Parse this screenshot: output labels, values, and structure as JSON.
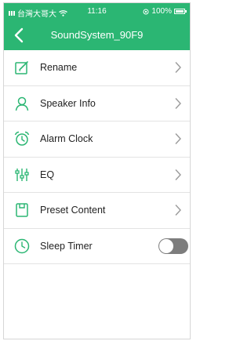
{
  "status_bar": {
    "carrier": "台灣大哥大",
    "time": "11:16",
    "battery": "100%"
  },
  "header": {
    "title": "SoundSystem_90F9",
    "back_icon": "chevron-left-icon"
  },
  "menu": [
    {
      "label": "Rename",
      "icon": "edit-icon",
      "control": "chevron"
    },
    {
      "label": "Speaker Info",
      "icon": "person-icon",
      "control": "chevron"
    },
    {
      "label": "Alarm Clock",
      "icon": "alarm-clock-icon",
      "control": "chevron"
    },
    {
      "label": "EQ",
      "icon": "equalizer-icon",
      "control": "chevron"
    },
    {
      "label": "Preset Content",
      "icon": "preset-icon",
      "control": "chevron"
    },
    {
      "label": "Sleep Timer",
      "icon": "clock-icon",
      "control": "toggle",
      "enabled": false
    }
  ],
  "colors": {
    "accent": "#2bb673",
    "toggle_off": "#7d7d7d",
    "icon": "#2bb673",
    "chevron": "#9a9a9a"
  }
}
